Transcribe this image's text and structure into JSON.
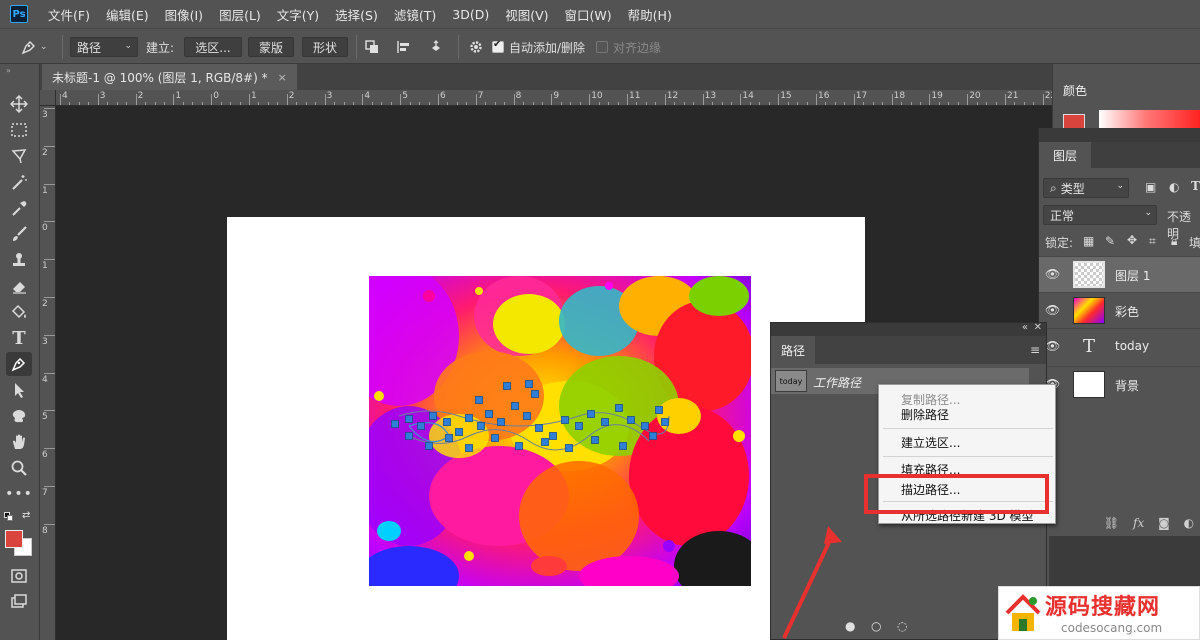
{
  "app": {
    "logo_text": "Ps"
  },
  "menu": [
    "文件(F)",
    "编辑(E)",
    "图像(I)",
    "图层(L)",
    "文字(Y)",
    "选择(S)",
    "滤镜(T)",
    "3D(D)",
    "视图(V)",
    "窗口(W)",
    "帮助(H)"
  ],
  "options_bar": {
    "mode_select": "路径",
    "make_label": "建立:",
    "selection_button": "选区...",
    "mask_button": "蒙版",
    "shape_button": "形状",
    "auto_add_delete_label": "自动添加/删除",
    "auto_add_delete_checked": true,
    "align_edges_label": "对齐边缘",
    "align_edges_enabled": false
  },
  "document_tab": {
    "title": "未标题-1 @ 100% (图层 1, RGB/8#) *",
    "close": "×"
  },
  "ruler": {
    "h_labels": [
      "4",
      "3",
      "2",
      "1",
      "0",
      "1",
      "2",
      "3",
      "4",
      "5",
      "6",
      "7",
      "8",
      "9",
      "10",
      "11",
      "12",
      "13",
      "14",
      "15",
      "16",
      "17",
      "18",
      "19",
      "20",
      "21",
      "22"
    ],
    "v_labels": [
      "3",
      "2",
      "1",
      "0",
      "1",
      "2",
      "3",
      "4",
      "5",
      "6",
      "7",
      "8"
    ]
  },
  "color_panel": {
    "tab_label": "颜色",
    "foreground_color": "#d9443c"
  },
  "layers_panel": {
    "tab_label": "图层",
    "filter_label": "类型",
    "blend_mode": "正常",
    "opacity_label": "不透明",
    "lock_label": "锁定:",
    "fill_short": "填",
    "layers": [
      {
        "name": "图层 1",
        "selected": true,
        "thumb": "transparent"
      },
      {
        "name": "彩色",
        "selected": false,
        "thumb": "image"
      },
      {
        "name": "today",
        "selected": false,
        "thumb": "text"
      },
      {
        "name": "背景",
        "selected": false,
        "thumb": "white"
      }
    ]
  },
  "paths_panel": {
    "tab_label": "路径",
    "work_path_name": "工作路径",
    "work_path_thumb_text": "today"
  },
  "context_menu": {
    "items": [
      {
        "label": "复制路径...",
        "disabled": true
      },
      {
        "label": "删除路径",
        "disabled": false
      },
      {
        "label": "建立选区...",
        "disabled": false
      },
      {
        "label": "填充路径...",
        "disabled": false
      },
      {
        "label": "描边路径...",
        "disabled": false,
        "highlighted": true
      },
      {
        "label": "从所选路径新建 3D 模型",
        "disabled": false
      }
    ]
  },
  "watermark": {
    "title": "源码搜藏网",
    "url": "codesocang.com"
  },
  "colors": {
    "highlight": "#e8312f",
    "panel": "#535353",
    "canvas_bg": "#282828"
  }
}
